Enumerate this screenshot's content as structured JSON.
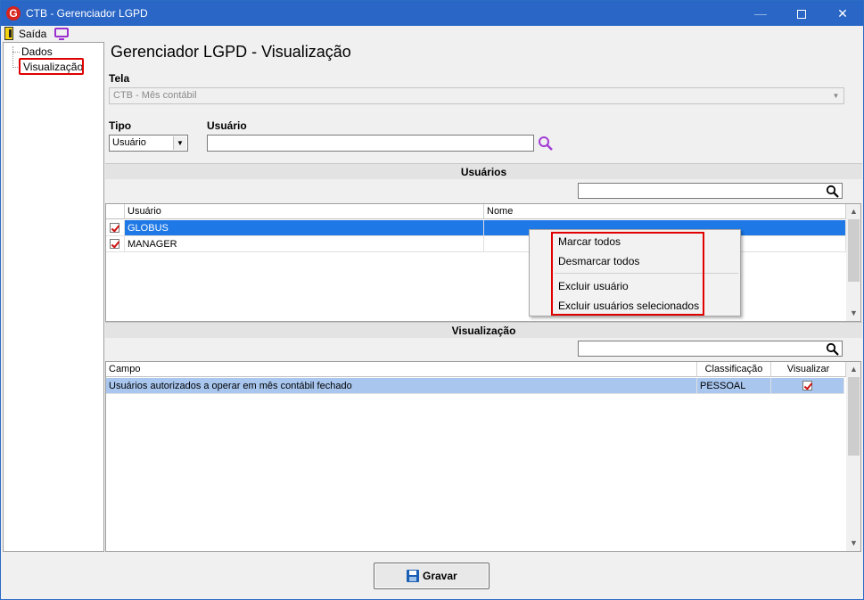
{
  "window": {
    "title": "CTB - Gerenciador LGPD",
    "app_icon": "G",
    "minimize": "—",
    "close": "✕"
  },
  "menu": {
    "exit_label": "Saída"
  },
  "tree": {
    "items": [
      "Dados",
      "Visualização"
    ]
  },
  "main": {
    "title": "Gerenciador LGPD - Visualização",
    "tela_label": "Tela",
    "tela_value": "CTB - Mês contábil",
    "tipo_label": "Tipo",
    "tipo_value": "Usuário",
    "usuario_label": "Usuário",
    "usuario_value": ""
  },
  "usuarios_section": {
    "title": "Usuários",
    "columns": [
      "Usuário",
      "Nome"
    ],
    "rows": [
      {
        "checked": true,
        "usuario": "GLOBUS",
        "nome": "",
        "selected": true
      },
      {
        "checked": true,
        "usuario": "MANAGER",
        "nome": "",
        "selected": false
      }
    ]
  },
  "context_menu": {
    "items": [
      "Marcar todos",
      "Desmarcar todos",
      "Excluir usuário",
      "Excluir usuários selecionados"
    ]
  },
  "visualizacao_section": {
    "title": "Visualização",
    "columns": [
      "Campo",
      "Classificação",
      "Visualizar"
    ],
    "rows": [
      {
        "campo": "Usuários autorizados a operar em mês contábil fechado",
        "classificacao": "PESSOAL",
        "visualizar": true
      }
    ]
  },
  "footer": {
    "save_label": "Gravar"
  },
  "colors": {
    "titlebar": "#2a66c6",
    "selection": "#1e78e6",
    "row_highlight": "#a8c6ee",
    "highlight_box": "#e00000"
  }
}
